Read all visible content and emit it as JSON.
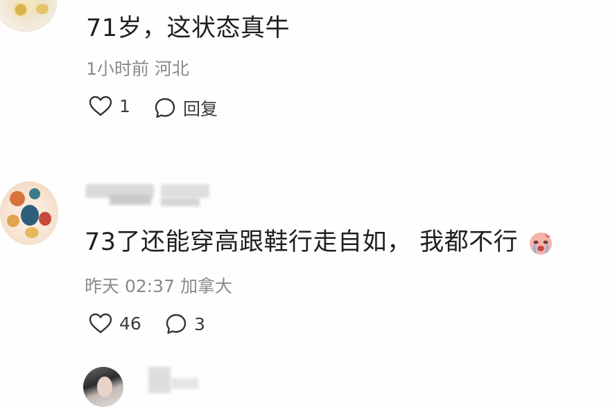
{
  "comments": [
    {
      "text": "71岁，这状态真牛",
      "meta": "1小时前 河北",
      "likes": "1",
      "reply_label": "回复"
    },
    {
      "text": "73了还能穿高跟鞋行走自如， 我都不行",
      "emoji": "crying-face-emoji",
      "meta": "昨天 02:37 加拿大",
      "likes": "46",
      "replies": "3"
    },
    {
      "text": ""
    }
  ],
  "colors": {
    "text": "#1f1f1f",
    "meta": "#8a8a8a",
    "icon": "#3a3a3a",
    "background": "#fefefe"
  },
  "icons": [
    "heart-icon",
    "comment-bubble-icon"
  ]
}
